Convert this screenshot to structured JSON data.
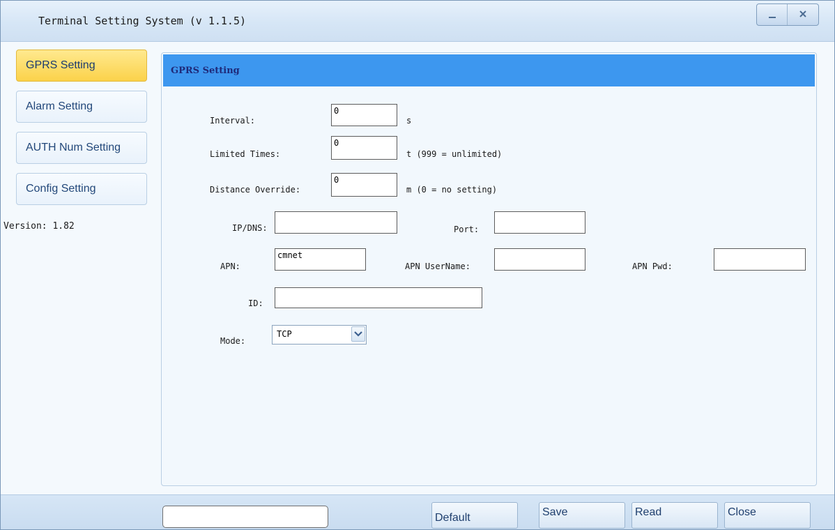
{
  "window": {
    "title": "Terminal Setting System (v 1.1.5)",
    "minimize_icon": "minimize-icon",
    "close_icon": "close-icon"
  },
  "sidebar": {
    "items": [
      {
        "label": "GPRS Setting",
        "active": true
      },
      {
        "label": "Alarm Setting",
        "active": false
      },
      {
        "label": "AUTH Num Setting",
        "active": false
      },
      {
        "label": "Config Setting",
        "active": false
      }
    ],
    "version": "Version: 1.82"
  },
  "panel": {
    "title": "GPRS Setting",
    "interval": {
      "label": "Interval:",
      "value": "0",
      "unit": "s"
    },
    "limited_times": {
      "label": "Limited Times:",
      "value": "0",
      "unit": "t (999 = unlimited)"
    },
    "distance_override": {
      "label": "Distance Override:",
      "value": "0",
      "unit": "m (0 = no setting)"
    },
    "ip_dns": {
      "label": "IP/DNS:",
      "value": ""
    },
    "port": {
      "label": "Port:",
      "value": ""
    },
    "apn": {
      "label": "APN:",
      "value": "cmnet"
    },
    "apn_username": {
      "label": "APN UserName:",
      "value": ""
    },
    "apn_pwd": {
      "label": "APN Pwd:",
      "value": ""
    },
    "id": {
      "label": "ID:",
      "value": ""
    },
    "mode": {
      "label": "Mode:",
      "value": "TCP"
    }
  },
  "footer": {
    "status_value": "",
    "buttons": {
      "default": "Default",
      "save": "Save",
      "read": "Read",
      "close": "Close"
    }
  },
  "colors": {
    "panel_header": "#3d97ef",
    "active_tab": "#fbd24a",
    "title_text": "#1f2a7a"
  }
}
